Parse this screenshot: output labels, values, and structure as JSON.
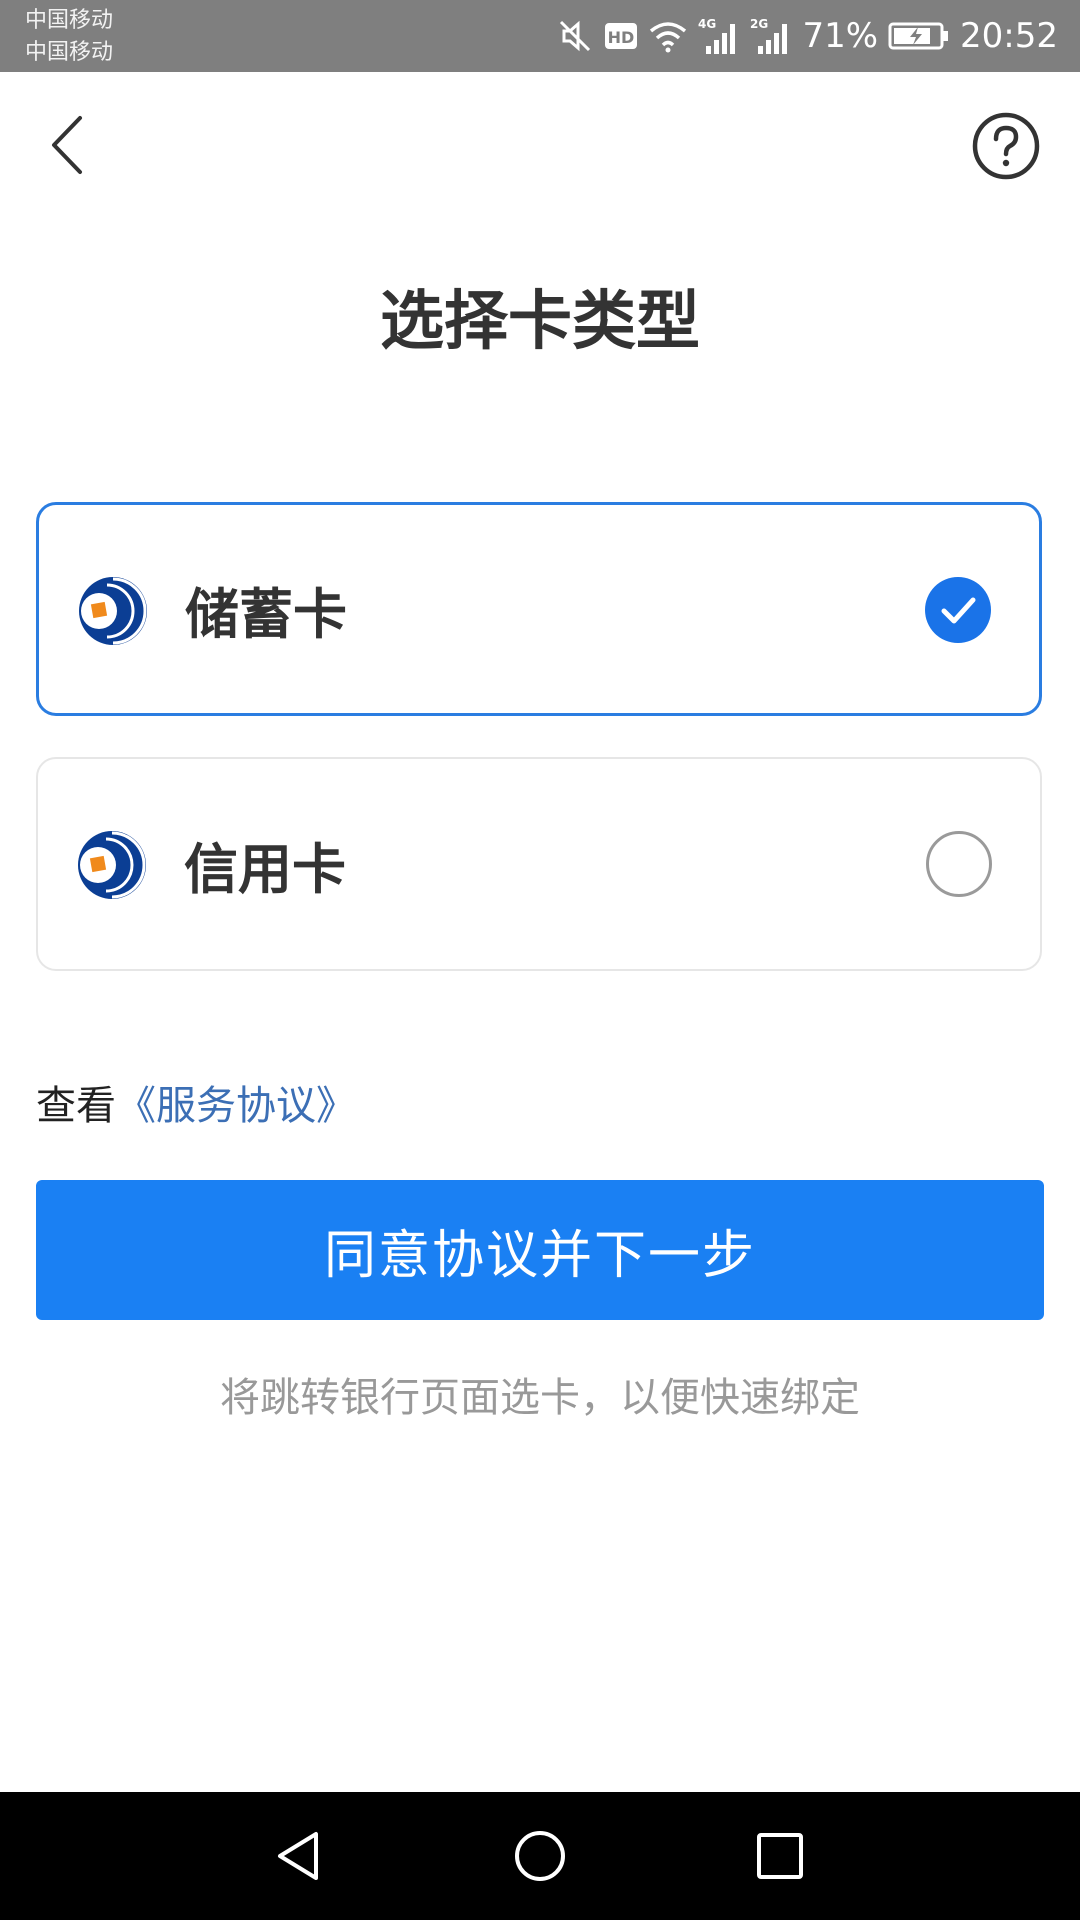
{
  "status_bar": {
    "carrier_1": "中国移动",
    "carrier_2": "中国移动",
    "battery_percent": "71%",
    "time": "20:52",
    "network_1": "4G",
    "network_2": "2G",
    "hd_badge": "HD",
    "icons": [
      "mute-icon",
      "hd-icon",
      "wifi-icon",
      "signal-4g-icon",
      "signal-2g-icon",
      "battery-charging-icon"
    ]
  },
  "header": {
    "back_icon": "chevron-left-icon",
    "help_icon": "question-circle-icon"
  },
  "title": "选择卡类型",
  "card_types": [
    {
      "label": "储蓄卡",
      "selected": true
    },
    {
      "label": "信用卡",
      "selected": false
    }
  ],
  "agreement": {
    "prefix": "查看",
    "link": "《服务协议》"
  },
  "primary_button": "同意协议并下一步",
  "hint": "将跳转银行页面选卡，以便快速绑定",
  "colors": {
    "accent": "#1a80f3",
    "selected_border": "#2a7de1",
    "link": "#3c6fb5",
    "logo_blue": "#0b3e94",
    "logo_orange": "#f08a1c"
  },
  "nav_bar": {
    "icons": [
      "nav-back-icon",
      "nav-home-icon",
      "nav-recent-icon"
    ]
  }
}
